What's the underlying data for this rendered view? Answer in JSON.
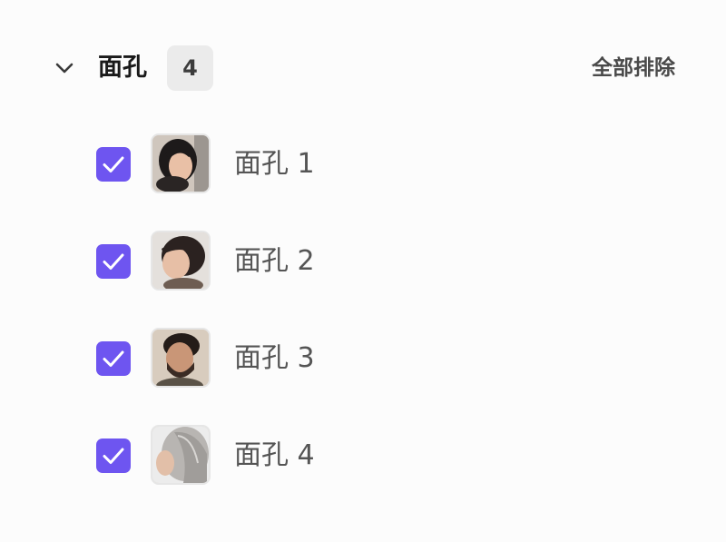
{
  "section": {
    "title": "面孔",
    "count": "4",
    "exclude_all_label": "全部排除",
    "collapse_icon": "chevron-down-icon"
  },
  "colors": {
    "accent": "#6e55f0",
    "badge_bg": "#ebebeb",
    "background": "#fcfcfc"
  },
  "faces": [
    {
      "label": "面孔 1",
      "checked": true
    },
    {
      "label": "面孔 2",
      "checked": true
    },
    {
      "label": "面孔 3",
      "checked": true
    },
    {
      "label": "面孔 4",
      "checked": true
    }
  ]
}
